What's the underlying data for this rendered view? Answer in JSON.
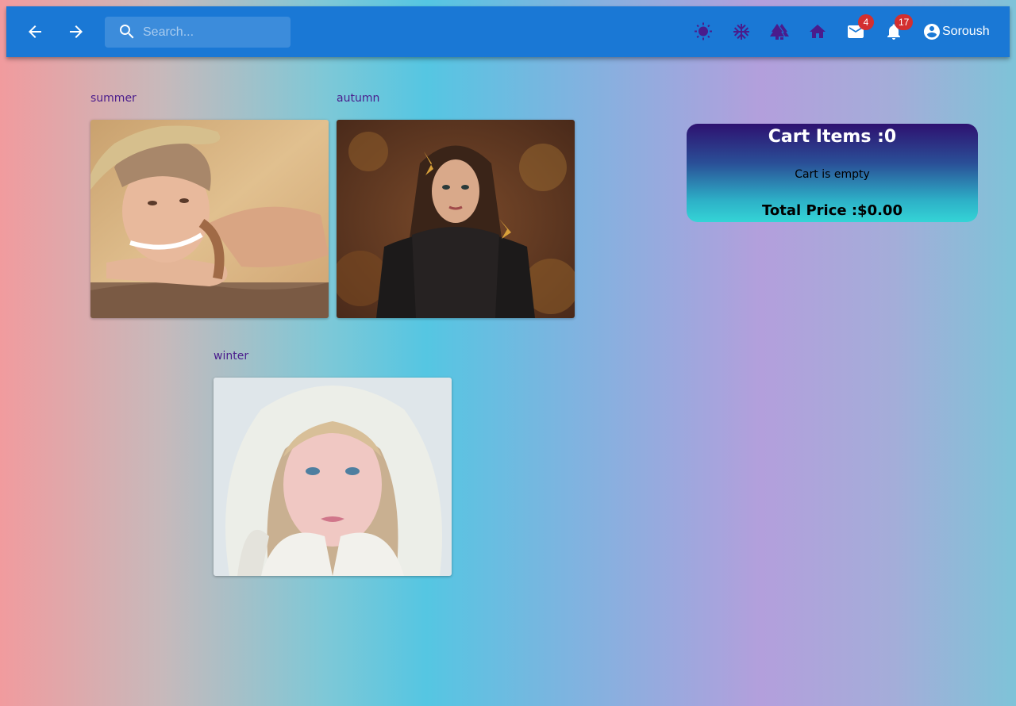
{
  "colors": {
    "appbar": "#1a78d5",
    "nav_icon": "#ffffff",
    "season_icon": "#4a1c8c",
    "badge": "#d32f2f",
    "label_text": "#4a1c8c",
    "cart_gradient_top": "#2e1170",
    "cart_gradient_bottom": "#34d4d6"
  },
  "header": {
    "back_icon": "arrow-left-icon",
    "forward_icon": "arrow-right-icon",
    "search": {
      "icon": "search-icon",
      "placeholder": "Search...",
      "value": ""
    },
    "actions": [
      {
        "icon": "sun-icon",
        "name": "summer"
      },
      {
        "icon": "snowflake-icon",
        "name": "winter"
      },
      {
        "icon": "trees-icon",
        "name": "autumn"
      },
      {
        "icon": "home-icon",
        "name": "home"
      }
    ],
    "mail": {
      "icon": "mail-icon",
      "badge": "4"
    },
    "notifications": {
      "icon": "bell-icon",
      "badge": "17"
    },
    "user": {
      "icon": "account-circle-icon",
      "name": "Soroush"
    }
  },
  "gallery": {
    "cards": [
      {
        "label": "summer",
        "image": "woman in straw hat lying on a rock"
      },
      {
        "label": "autumn",
        "image": "woman with long hair among autumn leaves"
      },
      {
        "label": "winter",
        "image": "woman in white fur hood in snow"
      }
    ]
  },
  "cart": {
    "title": "Cart Items :0",
    "empty_text": "Cart is empty",
    "total": "Total Price :$0.00"
  }
}
